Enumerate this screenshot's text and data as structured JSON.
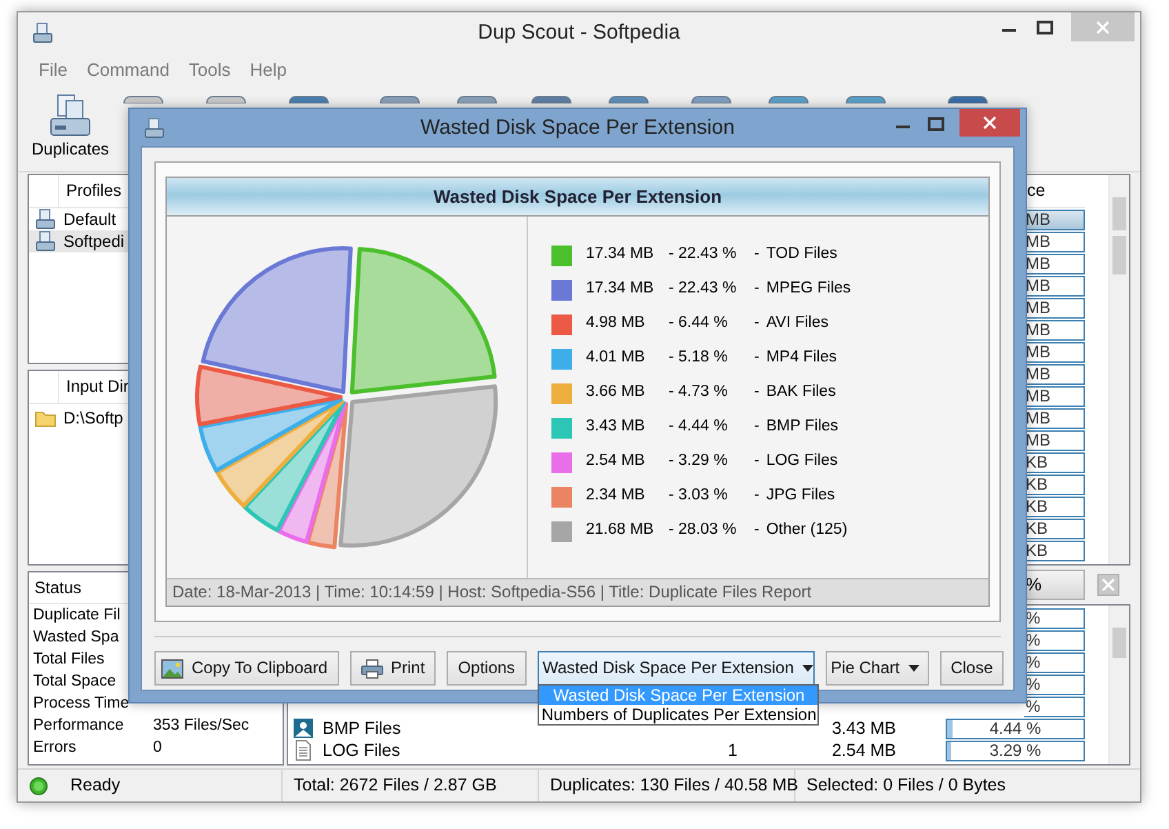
{
  "main_window": {
    "title": "Dup Scout - Softpedia",
    "menu": [
      "File",
      "Command",
      "Tools",
      "Help"
    ],
    "toolbar": {
      "label": "Duplicates"
    },
    "profiles": {
      "header": "Profiles",
      "items": [
        {
          "label": "Default",
          "selected": false
        },
        {
          "label": "Softpedi",
          "selected": true
        }
      ]
    },
    "input_dirs": {
      "header": "Input Dir",
      "items": [
        "D:\\Softp"
      ]
    },
    "status": {
      "header": "Status",
      "rows": [
        {
          "label": "Duplicate Fil"
        },
        {
          "label": "Wasted Spa"
        },
        {
          "label": "Total Files"
        },
        {
          "label": "Total Space"
        },
        {
          "label": "Process Time"
        },
        {
          "label": "Performance",
          "value": "353 Files/Sec"
        },
        {
          "label": "Errors",
          "value": "0"
        }
      ]
    },
    "upper_list": {
      "column_header": "ce",
      "cells": [
        {
          "text": "MB",
          "selected": true
        },
        {
          "text": "MB",
          "selected": false
        },
        {
          "text": "MB",
          "selected": false
        },
        {
          "text": "MB",
          "selected": false
        },
        {
          "text": "MB",
          "selected": false
        },
        {
          "text": "MB",
          "selected": false
        },
        {
          "text": "MB",
          "selected": false
        },
        {
          "text": "MB",
          "selected": false
        },
        {
          "text": "MB",
          "selected": false
        },
        {
          "text": "MB",
          "selected": false
        },
        {
          "text": "MB",
          "selected": false
        },
        {
          "text": "KB",
          "selected": false
        },
        {
          "text": "KB",
          "selected": false
        },
        {
          "text": "KB",
          "selected": false
        },
        {
          "text": "KB",
          "selected": false
        },
        {
          "text": "KB",
          "selected": false
        }
      ]
    },
    "progress_field": "%",
    "lower_list": {
      "rows": [
        {
          "kind": "partial",
          "percent": "%"
        },
        {
          "kind": "partial",
          "percent": "%"
        },
        {
          "kind": "partial",
          "percent": "%"
        },
        {
          "kind": "partial",
          "percent": "%"
        },
        {
          "kind": "partial",
          "percent": "%"
        },
        {
          "kind": "full",
          "name": "BMP Files",
          "size": "3.43 MB",
          "percent": "4.44 %",
          "level": 0.0444
        },
        {
          "kind": "full",
          "name": "LOG Files",
          "count": "1",
          "size": "2.54 MB",
          "percent": "3.29 %",
          "level": 0.0329
        }
      ]
    },
    "status_bar": [
      "Ready",
      "Total: 2672 Files / 2.87 GB",
      "Duplicates: 130 Files / 40.58 MB",
      "Selected: 0 Files / 0 Bytes"
    ]
  },
  "dialog": {
    "title": "Wasted Disk Space Per Extension",
    "chart_data": {
      "type": "pie",
      "title": "Wasted Disk Space Per Extension",
      "categories": [
        "TOD Files",
        "MPEG Files",
        "AVI Files",
        "MP4 Files",
        "BAK Files",
        "BMP Files",
        "LOG Files",
        "JPG Files",
        "Other (125)"
      ],
      "series": [
        {
          "values": [
            17.34,
            17.34,
            4.98,
            4.01,
            3.66,
            3.43,
            2.54,
            2.34,
            21.68
          ]
        }
      ]
    },
    "legend": [
      {
        "size": "17.34 MB",
        "percent": "- 22.43 %",
        "separator": "-",
        "color": "#4cbf2c"
      },
      {
        "size": "17.34 MB",
        "percent": "- 22.43 %",
        "separator": "-",
        "color": "#6a78d6"
      },
      {
        "size": "4.98 MB",
        "percent": "- 6.44 %",
        "separator": "-",
        "color": "#ec5a46"
      },
      {
        "size": "4.01 MB",
        "percent": "- 5.18 %",
        "separator": "-",
        "color": "#3eaeea"
      },
      {
        "size": "3.66 MB",
        "percent": "- 4.73 %",
        "separator": "-",
        "color": "#eeae3e"
      },
      {
        "size": "3.43 MB",
        "percent": "- 4.44 %",
        "separator": "-",
        "color": "#2cc6b6"
      },
      {
        "size": "2.54 MB",
        "percent": "- 3.29 %",
        "separator": "-",
        "color": "#ea6eea"
      },
      {
        "size": "2.34 MB",
        "percent": "- 3.03 %",
        "separator": "-",
        "color": "#ea8462"
      },
      {
        "size": "21.68 MB",
        "percent": "- 28.03 %",
        "separator": "-",
        "color": "#a6a6a6"
      }
    ],
    "footer": "Date: 18-Mar-2013 | Time: 10:14:59 | Host: Softpedia-S56 | Title: Duplicate Files Report",
    "buttons": [
      {
        "kind": "button",
        "label": "Copy To Clipboard"
      },
      {
        "kind": "button",
        "label": "Print"
      },
      {
        "kind": "button",
        "label": "Options"
      },
      {
        "kind": "select",
        "label": "Wasted Disk Space Per Extension",
        "expanded": true,
        "options": [
          {
            "label": "Wasted Disk Space Per Extension",
            "selected": true
          },
          {
            "label": "Numbers of Duplicates Per Extension",
            "selected": false
          }
        ]
      },
      {
        "kind": "select",
        "label": "Pie Chart",
        "expanded": false
      },
      {
        "kind": "button",
        "label": "Close"
      }
    ]
  }
}
